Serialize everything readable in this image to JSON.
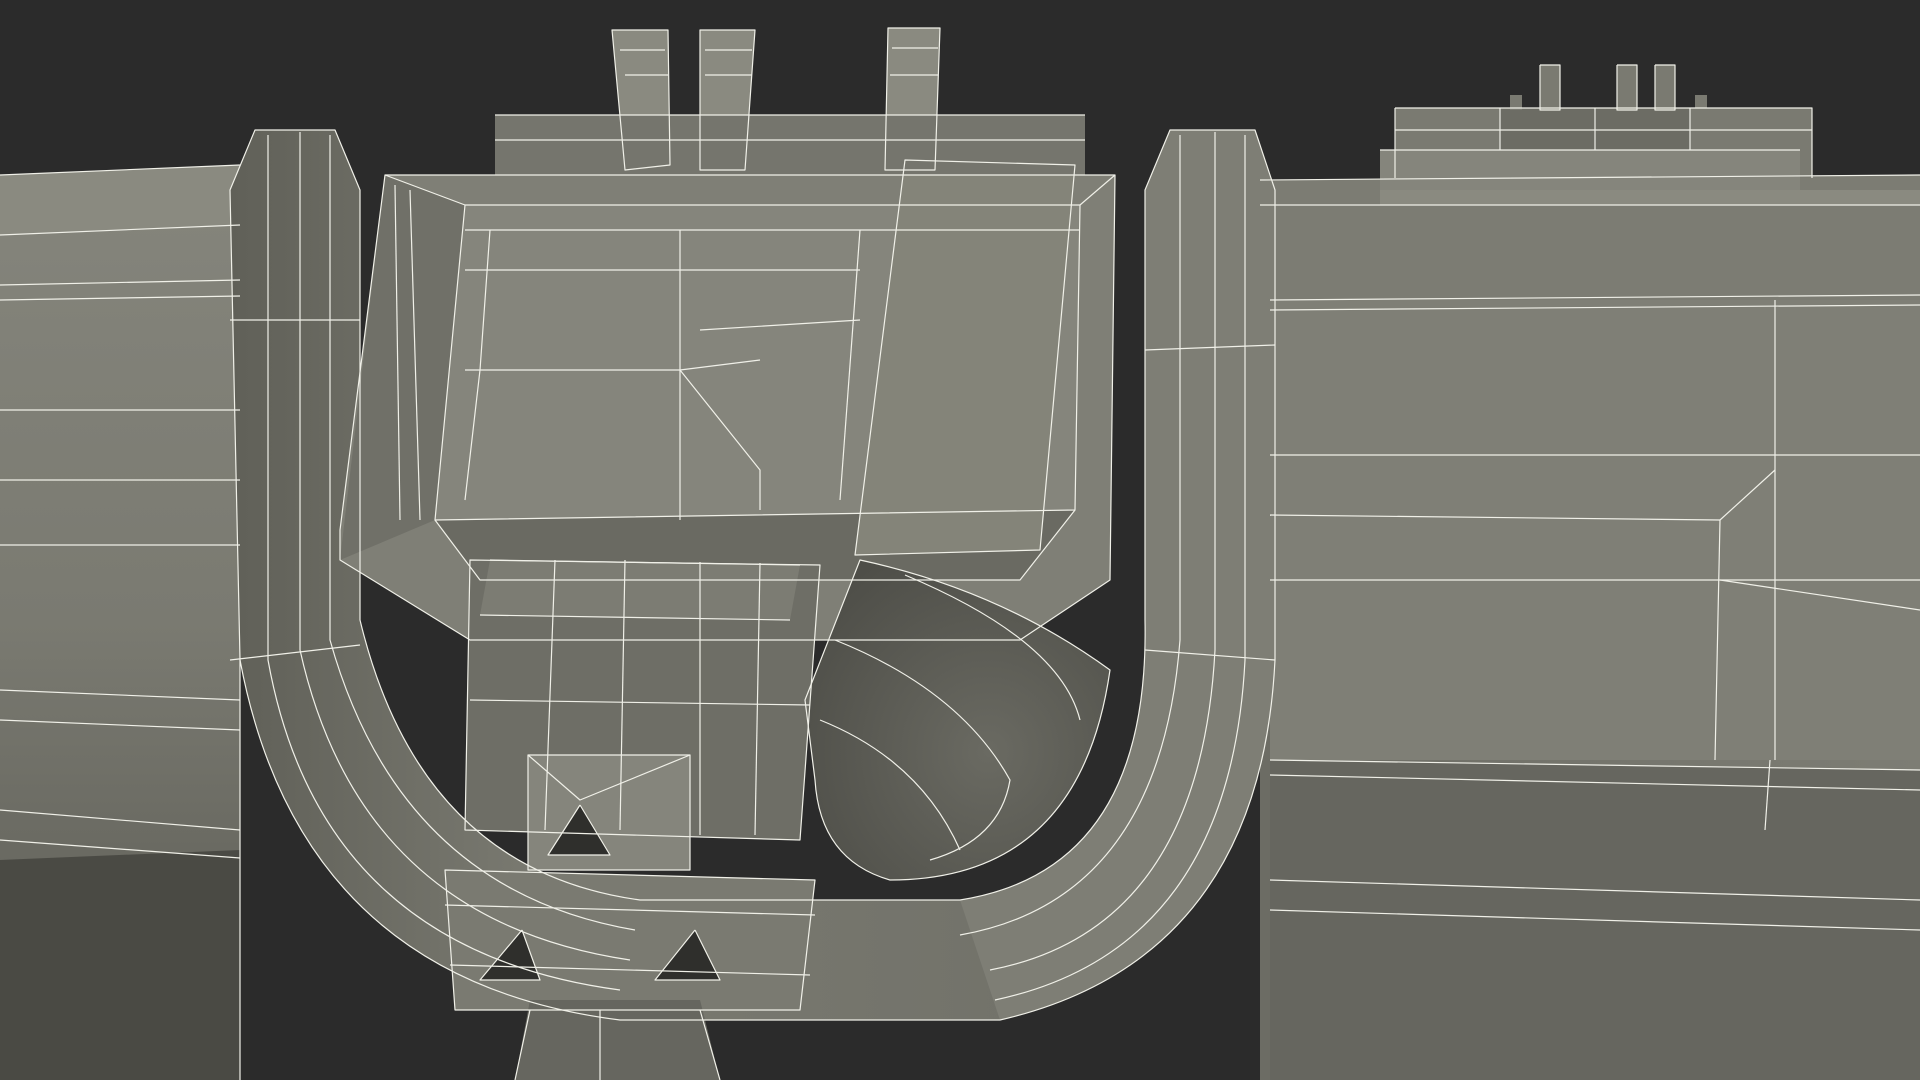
{
  "scene": {
    "subject": "3d-wireframe-mechanical-part",
    "background_color": "#2b2b2b",
    "surface_color": "#7b7b72",
    "surface_shadow_color": "#5e5e57",
    "surface_dark_color": "#4a4a44",
    "surface_light_color": "#8a8a80",
    "wire_color": "#f0f0e8"
  }
}
